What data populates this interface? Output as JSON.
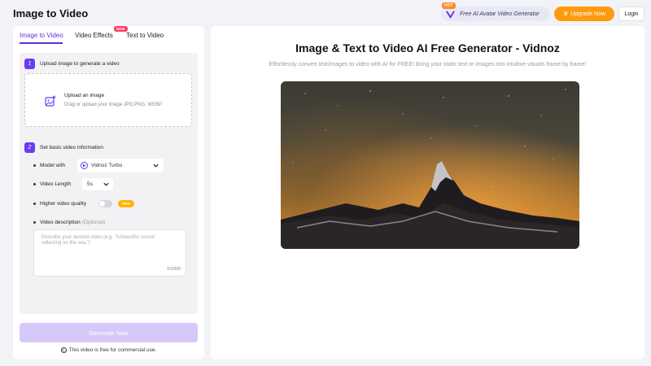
{
  "header": {
    "title": "Image to Video",
    "promo_badge": "HOT",
    "promo_text": "Free AI Avatar Video Generator",
    "upgrade_label": "Upgrade Now",
    "login_label": "Login",
    "accent": "#ff9a0e"
  },
  "tabs": [
    {
      "label": "Image to Video",
      "active": true
    },
    {
      "label": "Video Effects",
      "badge": "NEW"
    },
    {
      "label": "Text to Video"
    }
  ],
  "step1": {
    "number": "1",
    "title": "Upload image to generate a video",
    "upload_title": "Upload an image",
    "upload_hint": "Drag or upload your image JPG,PNG, WEBP"
  },
  "step2": {
    "number": "2",
    "title": "Set basic video information",
    "model_label": "Model with",
    "model_value": "Vidnoz Turbo",
    "length_label": "Video Length",
    "length_value": "5s",
    "quality_label": "Higher video quality",
    "quality_badge": "PRO",
    "quality_on": false,
    "desc_label": "Video description",
    "desc_optional": "(Optional)",
    "desc_placeholder": "Describe your desired video (e.g. \"A beautiful sunset reflecting on the sea.\")",
    "desc_count": "0/2000"
  },
  "generate_label": "Generate Now",
  "commercial_note": "This video is free for commercial use.",
  "main": {
    "title": "Image & Text to Video AI Free Generator - Vidnoz",
    "subtitle": "Effortlessly convert text/images to video with AI for FREE! Bring your static text or images into intuitive visuals frame by frame!"
  },
  "colors": {
    "brand": "#5b32d6",
    "step": "#6a3df0",
    "generate_disabled": "#d7c8fb"
  }
}
